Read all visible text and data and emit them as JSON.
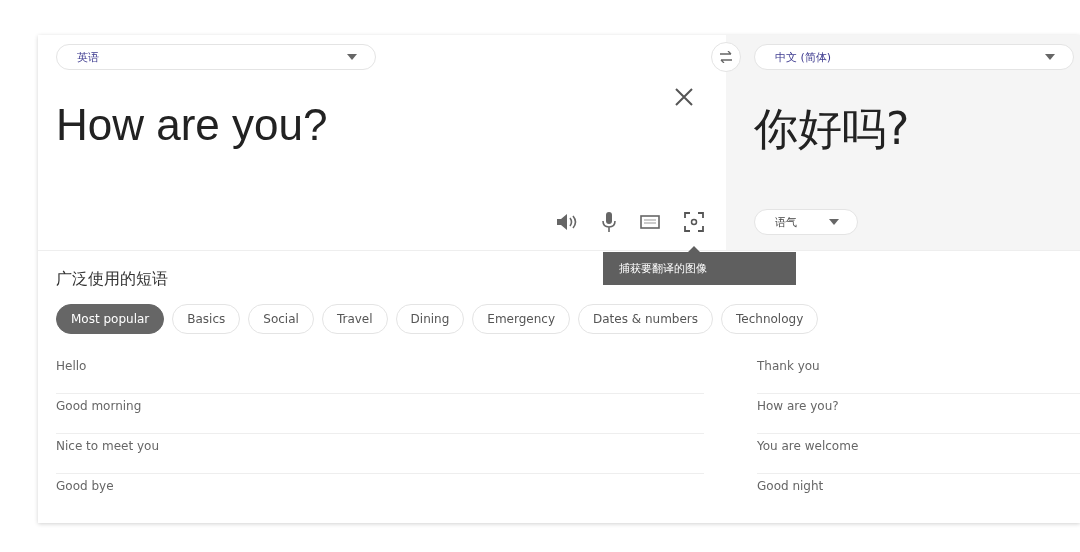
{
  "source": {
    "language": "英语",
    "text": "How are you?"
  },
  "target": {
    "language": "中文 (简体)",
    "text": "你好吗?",
    "tone": "语气"
  },
  "tooltip": "捕获要翻译的图像",
  "phrases": {
    "title": "广泛使用的短语",
    "categories": [
      {
        "label": "Most popular",
        "selected": true
      },
      {
        "label": "Basics",
        "selected": false
      },
      {
        "label": "Social",
        "selected": false
      },
      {
        "label": "Travel",
        "selected": false
      },
      {
        "label": "Dining",
        "selected": false
      },
      {
        "label": "Emergency",
        "selected": false
      },
      {
        "label": "Dates & numbers",
        "selected": false
      },
      {
        "label": "Technology",
        "selected": false
      }
    ],
    "left": [
      "Hello",
      "Good morning",
      "Nice to meet you",
      "Good bye"
    ],
    "right": [
      "Thank you",
      "How are you?",
      "You are welcome",
      "Good night"
    ]
  }
}
